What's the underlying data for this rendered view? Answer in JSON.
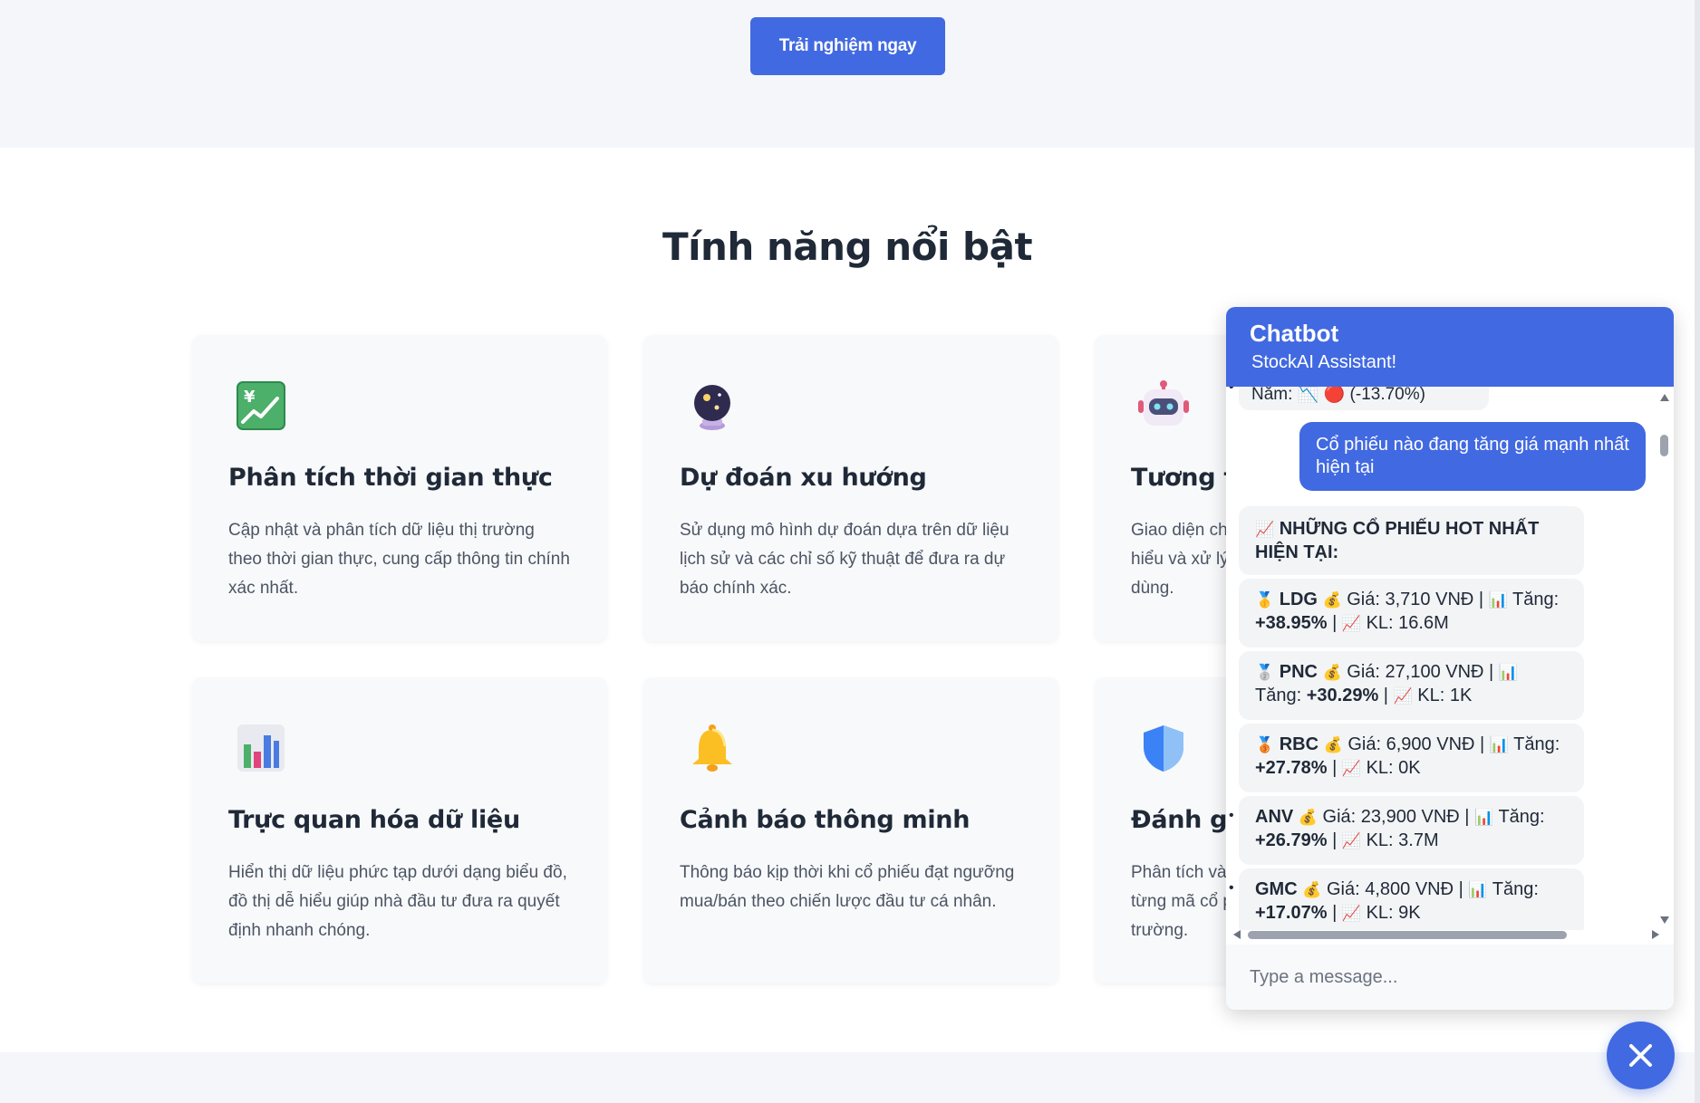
{
  "hero": {
    "cta_label": "Trải nghiệm ngay"
  },
  "features": {
    "title": "Tính năng nổi bật",
    "cards": [
      {
        "title": "Phân tích thời gian thực",
        "desc": "Cập nhật và phân tích dữ liệu thị trường theo thời gian thực, cung cấp thông tin chính xác nhất.",
        "icon": "chart-increasing-icon"
      },
      {
        "title": "Dự đoán xu hướng",
        "desc": "Sử dụng mô hình dự đoán dựa trên dữ liệu lịch sử và các chỉ số kỹ thuật để đưa ra dự báo chính xác.",
        "icon": "crystal-ball-icon"
      },
      {
        "title": "Tương tá",
        "desc": "Giao diện ch hiểu và xử lý dùng.",
        "icon": "robot-icon"
      },
      {
        "title": "Trực quan hóa dữ liệu",
        "desc": "Hiển thị dữ liệu phức tạp dưới dạng biểu đồ, đồ thị dễ hiểu giúp nhà đầu tư đưa ra quyết định nhanh chóng.",
        "icon": "bar-chart-icon"
      },
      {
        "title": "Cảnh báo thông minh",
        "desc": "Thông báo kịp thời khi cổ phiếu đạt ngưỡng mua/bán theo chiến lược đầu tư cá nhân.",
        "icon": "bell-icon"
      },
      {
        "title": "Đánh gi",
        "desc": "Phân tích và từng mã cổ p trường.",
        "icon": "shield-icon"
      }
    ]
  },
  "chat": {
    "title": "Chatbot",
    "subtitle": "StockAI Assistant!",
    "clipped_text": "Năm: 📉 🔴 (-13.70%)",
    "user_message": "Cổ phiếu nào đang tăng giá mạnh nhất hiện tại",
    "hot_header": "NHỮNG CỔ PHIẾU HOT NHẤT HIỆN TẠI:",
    "labels": {
      "price": "Giá:",
      "rise": "Tăng:",
      "volume": "KL:"
    },
    "stocks": [
      {
        "medal": "🥇",
        "code": "LDG",
        "price": "3,710 VNĐ",
        "rise": "+38.95%",
        "volume": "16.6M"
      },
      {
        "medal": "🥈",
        "code": "PNC",
        "price": "27,100 VNĐ",
        "rise": "+30.29%",
        "volume": "1K"
      },
      {
        "medal": "🥉",
        "code": "RBC",
        "price": "6,900 VNĐ",
        "rise": "+27.78%",
        "volume": "0K"
      },
      {
        "medal": "",
        "code": "ANV",
        "price": "23,900 VNĐ",
        "rise": "+26.79%",
        "volume": "3.7M"
      },
      {
        "medal": "",
        "code": "GMC",
        "price": "4,800 VNĐ",
        "rise": "+17.07%",
        "volume": "9K"
      }
    ],
    "input_placeholder": "Type a message..."
  },
  "colors": {
    "accent": "#4169e1",
    "card_bg": "#f8f9fb",
    "hero_bg": "#f4f6fa"
  }
}
